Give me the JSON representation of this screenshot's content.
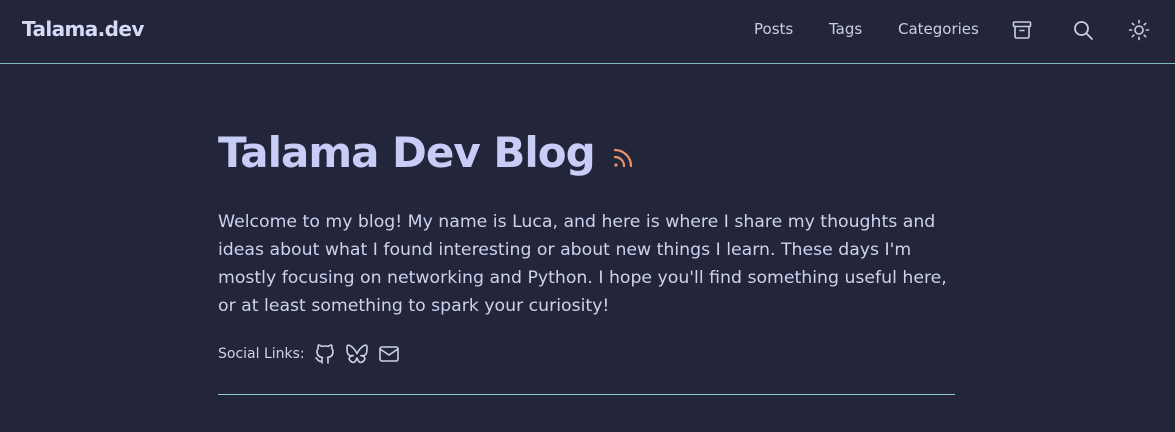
{
  "header": {
    "site_title": "Talama.dev",
    "nav": [
      {
        "label": "Posts"
      },
      {
        "label": "Tags"
      },
      {
        "label": "Categories"
      }
    ],
    "icons": [
      "archive-icon",
      "search-icon",
      "sun-icon"
    ]
  },
  "main": {
    "title": "Talama Dev Blog",
    "rss_icon": "rss-icon",
    "intro": "Welcome to my blog! My name is Luca, and here is where I share my thoughts and ideas about what I found interesting or about new things I learn. These days I'm mostly focusing on networking and Python. I hope you'll find something useful here, or at least something to spark your curiosity!",
    "social": {
      "label": "Social Links:",
      "icons": [
        "github-icon",
        "bluesky-icon",
        "mail-icon"
      ]
    }
  },
  "colors": {
    "background": "#23263a",
    "text": "#cdd1ee",
    "title": "#c7cdf7",
    "accent_rss": "#e8936a",
    "divider": "#8fc6cf"
  }
}
